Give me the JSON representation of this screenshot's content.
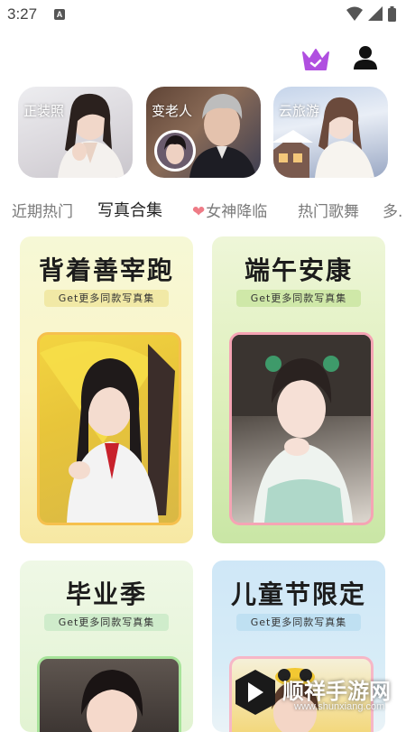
{
  "status_bar": {
    "time": "3:27",
    "notification_badge": "A"
  },
  "header": {
    "vip_icon": "crown-icon",
    "profile_icon": "person-icon",
    "vip_color": "#b04fe0"
  },
  "features": [
    {
      "label": "正装照"
    },
    {
      "label": "变老人"
    },
    {
      "label": "云旅游"
    }
  ],
  "tabs": [
    {
      "label": "近期热门"
    },
    {
      "label": "写真合集"
    },
    {
      "label": "女神降临"
    },
    {
      "label": "热门歌舞"
    },
    {
      "label": "多."
    }
  ],
  "albums": [
    {
      "title": "背着善宰跑",
      "subtitle": "Get更多同款写真集"
    },
    {
      "title": "端午安康",
      "subtitle": "Get更多同款写真集"
    },
    {
      "title": "毕业季",
      "subtitle": "Get更多同款写真集"
    },
    {
      "title": "儿童节限定",
      "subtitle": "Get更多同款写真集"
    }
  ],
  "watermark": {
    "name": "顺祥手游网",
    "url": "www.shunxiang.com"
  }
}
